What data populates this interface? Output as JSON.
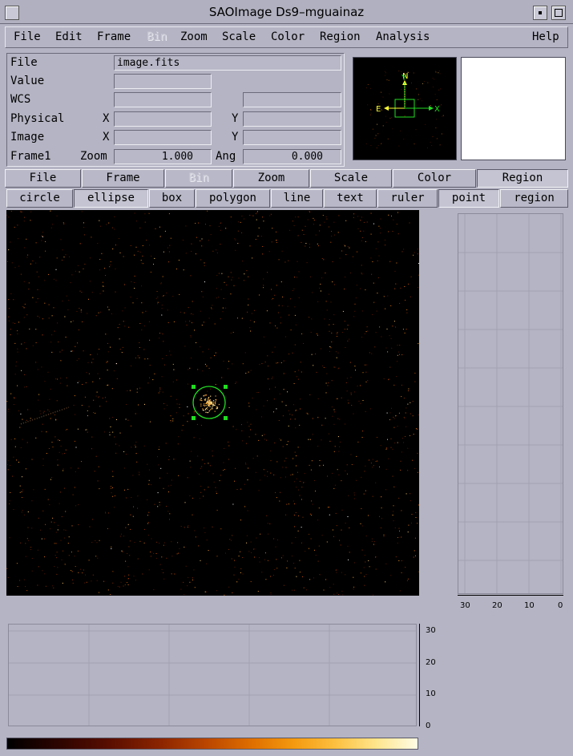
{
  "window": {
    "title": "SAOImage Ds9–mguainaz"
  },
  "menubar": {
    "items": [
      {
        "label": "File",
        "enabled": true
      },
      {
        "label": "Edit",
        "enabled": true
      },
      {
        "label": "Frame",
        "enabled": true
      },
      {
        "label": "Bin",
        "enabled": false
      },
      {
        "label": "Zoom",
        "enabled": true
      },
      {
        "label": "Scale",
        "enabled": true
      },
      {
        "label": "Color",
        "enabled": true
      },
      {
        "label": "Region",
        "enabled": true
      },
      {
        "label": "Analysis",
        "enabled": true
      },
      {
        "label": "Help",
        "enabled": true
      }
    ]
  },
  "info": {
    "file_label": "File",
    "file_value": "image.fits",
    "value_label": "Value",
    "value_value": "",
    "wcs_label": "WCS",
    "physical_label": "Physical",
    "image_label": "Image",
    "x_label": "X",
    "y_label": "Y",
    "frame_label": "Frame1",
    "zoom_label": "Zoom",
    "zoom_value": "1.000",
    "angle_label": "Ang",
    "angle_value": "0.000"
  },
  "panner": {
    "compass_n": "N",
    "compass_e": "E",
    "axis_x": "X",
    "axis_y": "Y"
  },
  "buttonbar": {
    "items": [
      {
        "label": "File",
        "state": "normal"
      },
      {
        "label": "Frame",
        "state": "normal"
      },
      {
        "label": "Bin",
        "state": "disabled"
      },
      {
        "label": "Zoom",
        "state": "normal"
      },
      {
        "label": "Scale",
        "state": "normal"
      },
      {
        "label": "Color",
        "state": "normal"
      },
      {
        "label": "Region",
        "state": "pressed"
      }
    ]
  },
  "regionbar": {
    "items": [
      {
        "label": "circle",
        "state": "normal"
      },
      {
        "label": "ellipse",
        "state": "pressed"
      },
      {
        "label": "box",
        "state": "normal"
      },
      {
        "label": "polygon",
        "state": "normal"
      },
      {
        "label": "line",
        "state": "normal"
      },
      {
        "label": "text",
        "state": "normal"
      },
      {
        "label": "ruler",
        "state": "normal"
      },
      {
        "label": "point",
        "state": "pressed"
      },
      {
        "label": "region",
        "state": "normal"
      }
    ]
  },
  "graphs": {
    "vertical_ticks": [
      "30",
      "20",
      "10",
      "0"
    ],
    "horizontal_ticks": [
      "30",
      "20",
      "10",
      "0"
    ]
  },
  "colors": {
    "region_green": "#22dd22",
    "panner_box": "#22dd22",
    "compass": "#ffff33",
    "background": "#b4b4c4"
  }
}
